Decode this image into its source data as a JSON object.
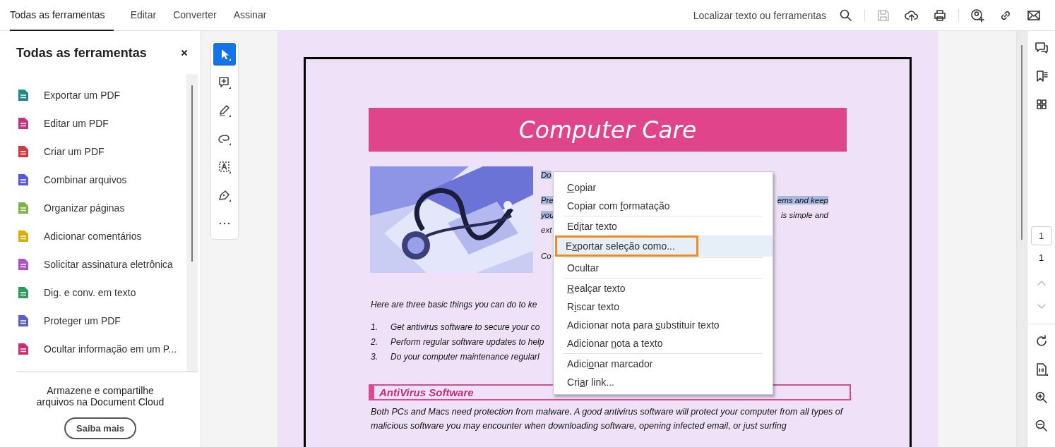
{
  "tabs": [
    {
      "label": "Todas as ferramentas",
      "selected": true
    },
    {
      "label": "Editar",
      "selected": false
    },
    {
      "label": "Converter",
      "selected": false
    },
    {
      "label": "Assinar",
      "selected": false
    }
  ],
  "search": {
    "label": "Localizar texto ou ferramentas"
  },
  "toolbar_buttons": [
    {
      "kind": "save",
      "disabled": true
    },
    {
      "kind": "upload",
      "disabled": false
    },
    {
      "kind": "print",
      "disabled": false
    },
    {
      "kind": "share-user",
      "disabled": false
    },
    {
      "kind": "link",
      "disabled": false
    },
    {
      "kind": "mail",
      "disabled": false
    }
  ],
  "tools_panel": {
    "title": "Todas as ferramentas",
    "items": [
      {
        "label": "Exportar um PDF",
        "color": "#1f8a8a"
      },
      {
        "label": "Editar um PDF",
        "color": "#c7307a"
      },
      {
        "label": "Criar um PDF",
        "color": "#d7373f"
      },
      {
        "label": "Combinar arquivos",
        "color": "#5258e4"
      },
      {
        "label": "Organizar páginas",
        "color": "#7cb342"
      },
      {
        "label": "Adicionar comentários",
        "color": "#d8b000"
      },
      {
        "label": "Solicitar assinatura eletrônica",
        "color": "#b04fc7"
      },
      {
        "label": "Dig. e conv. em texto",
        "color": "#2d9d5b"
      },
      {
        "label": "Proteger um PDF",
        "color": "#5b5fc7"
      },
      {
        "label": "Ocultar informação em um P...",
        "color": "#d02c6b"
      }
    ],
    "promo": {
      "text": "Armazene e compartilhe arquivos na Document Cloud",
      "button": "Saiba mais"
    }
  },
  "quick_tools": [
    {
      "kind": "select",
      "selected": true
    },
    {
      "kind": "comment",
      "selected": false
    },
    {
      "kind": "highlight",
      "selected": false
    },
    {
      "kind": "lasso",
      "selected": false
    },
    {
      "kind": "text-select",
      "selected": false
    },
    {
      "kind": "sign",
      "selected": false
    },
    {
      "kind": "more",
      "selected": false
    }
  ],
  "document": {
    "title": "Computer Care",
    "intro_rows": [
      {
        "left": {
          "text": "Do",
          "selected": true
        }
      },
      {
        "left": {
          "text": "Pre",
          "selected": true
        },
        "right": {
          "text": "ems and keep",
          "selected": true
        }
      },
      {
        "left": {
          "text": "you",
          "selected": true
        },
        "right": {
          "text": "is simple and",
          "selected": false
        }
      },
      {
        "left": {
          "text": "ext",
          "selected": false
        }
      },
      {
        "left": {
          "text": "Co",
          "selected": false
        }
      }
    ],
    "lead": "Here are three basic things you can do to ke",
    "steps": [
      {
        "number": "1.",
        "text": "Get antivirus software to secure your co"
      },
      {
        "number": "2.",
        "text": "Perform regular software updates to help"
      },
      {
        "number": "3.",
        "text": "Do your computer maintenance regularl"
      }
    ],
    "section": {
      "title": "AntiVirus Software",
      "paragraph": "Both PCs and Macs need protection from malware.  A good antivirus software will protect your computer from all types of malicious software you may encounter when downloading software, opening infected email, or just surfing"
    }
  },
  "context_menu": [
    {
      "kind": "item",
      "key": "C",
      "after": "opiar",
      "selected": false,
      "outlined": false
    },
    {
      "kind": "item",
      "before": "Copiar com ",
      "key": "f",
      "after": "ormatação",
      "selected": false,
      "outlined": false
    },
    {
      "kind": "separator"
    },
    {
      "kind": "item",
      "before": "Ed",
      "key": "i",
      "after": "tar texto",
      "selected": false,
      "outlined": false
    },
    {
      "kind": "item",
      "before": "E",
      "key": "x",
      "after": "portar seleção como...",
      "selected": true,
      "outlined": true
    },
    {
      "kind": "separator"
    },
    {
      "kind": "item",
      "before": "Ocultar",
      "selected": false,
      "outlined": false
    },
    {
      "kind": "separator"
    },
    {
      "kind": "item",
      "key": "R",
      "after": "ealçar texto",
      "selected": false,
      "outlined": false
    },
    {
      "kind": "item",
      "before": "R",
      "key": "i",
      "after": "scar texto",
      "selected": false,
      "outlined": false
    },
    {
      "kind": "item",
      "before": "Adicionar nota para ",
      "key": "s",
      "after": "ubstituir texto",
      "selected": false,
      "outlined": false
    },
    {
      "kind": "item",
      "before": "Adicionar ",
      "key": "n",
      "after": "ota a texto",
      "selected": false,
      "outlined": false
    },
    {
      "kind": "separator"
    },
    {
      "kind": "item",
      "before": "Adici",
      "key": "o",
      "after": "nar marcador",
      "selected": false,
      "outlined": false
    },
    {
      "kind": "item",
      "before": "Cri",
      "key": "a",
      "after": "r link...",
      "selected": false,
      "outlined": false
    }
  ],
  "right_rail": {
    "tools": [
      {
        "kind": "comments"
      },
      {
        "kind": "bookmarks"
      },
      {
        "kind": "thumbnails"
      }
    ],
    "page_field": {
      "value": "1"
    },
    "page_count": "1",
    "view_tools": [
      {
        "kind": "rotate"
      },
      {
        "kind": "fit-page"
      },
      {
        "kind": "zoom-in"
      },
      {
        "kind": "zoom-out"
      }
    ]
  }
}
